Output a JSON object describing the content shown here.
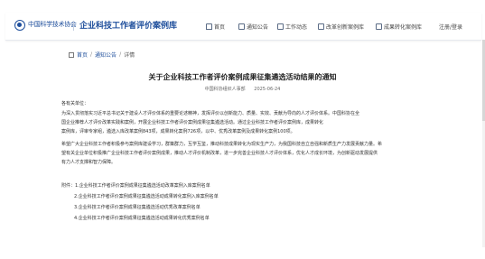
{
  "header": {
    "org_logo_text": "中国科学技术协会",
    "site_title": "企业科技工作者评价案例库",
    "nav": [
      {
        "label": "首页",
        "icon": "home-icon"
      },
      {
        "label": "通知公告",
        "icon": "notice-icon"
      },
      {
        "label": "工作动态",
        "icon": "news-icon"
      },
      {
        "label": "改革创新案例库",
        "icon": "library-icon"
      },
      {
        "label": "成果转化案例库",
        "icon": "document-icon"
      },
      {
        "label": "注册/登录",
        "icon": ""
      }
    ]
  },
  "breadcrumb": {
    "home": "首页",
    "section": "通知公告",
    "current": "详情"
  },
  "article": {
    "title": "关于企业科技工作者评价案例成果征集遴选活动结果的通知",
    "source": "中国科协组织人事部",
    "date": "2025-06-24",
    "salutation": "各有关单位：",
    "paragraph1": [
      "为深入贯彻落实习近平总书记关于建设人才评价体系的重要论述精神，发挥评价以创新能力、质量、实效、贡献为导向的人才评价体系。中国科协在全",
      "国企业推荐人才评价改革实践和案例，开展企业科技工作者评价案例成果征集遴选活动。通过企业科技工作者评价案例库，成果转化",
      "案例库，评审专家组，遴选入库改革案例843项，成果转化案例726项，以中、优秀改革案例及成果转化案例100项。"
    ],
    "paragraph2": [
      "希望广大企业科技工作者积极参与案例库建设学习，群策群力，互学互鉴，推动科技成果转化为现实生产力，为我国科技自立自强和新质生产力发展贡献力量。希",
      "望有关企业单位积极推广企业科技工作者评价案例成果，推动人才评价机制改革，进一步完善企业科技人才评价体系，优化人才成长环境，为创新驱动发展提供",
      "有力人才支撑和智力保障。"
    ],
    "attachments_label": "附件：",
    "attachments": [
      "1.企业科技工作者评价案例成果征集遴选活动改革案例入库案例名单",
      "2.企业科技工作者评价案例成果征集遴选活动成果转化案例入库案例名单",
      "3.企业科技工作者评价案例成果征集遴选活动优秀改革案例名单",
      "4.企业科技工作者评价案例成果征集遴选活动成果转化优秀案例名单"
    ]
  }
}
